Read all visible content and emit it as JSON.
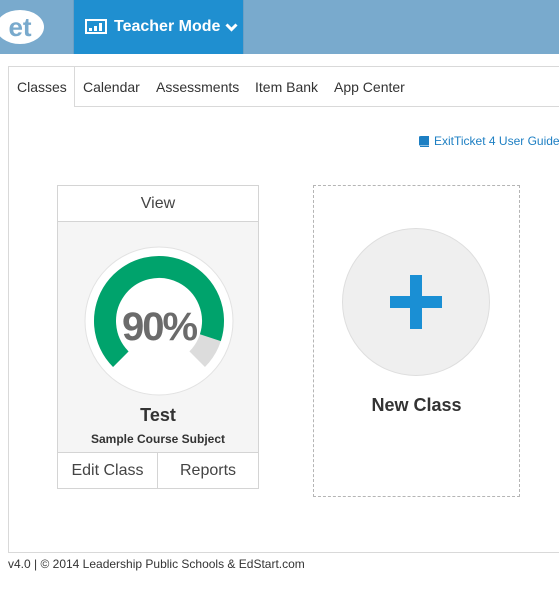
{
  "topbar": {
    "logo_text": "et",
    "mode_label": "Teacher Mode",
    "colors": {
      "bar": "#79aacd",
      "mode": "#1f8fd0"
    }
  },
  "tabs": [
    {
      "label": "Classes",
      "active": true
    },
    {
      "label": "Calendar",
      "active": false
    },
    {
      "label": "Assessments",
      "active": false
    },
    {
      "label": "Item Bank",
      "active": false
    },
    {
      "label": "App Center",
      "active": false
    }
  ],
  "guide_link": {
    "label": "ExitTicket 4 User Guide"
  },
  "class_card": {
    "view_label": "View",
    "score_text": "90%",
    "score_value": 90,
    "class_name": "Test",
    "subject": "Sample Course Subject",
    "edit_label": "Edit Class",
    "reports_label": "Reports",
    "gauge_color": "#00a36c"
  },
  "new_class": {
    "label": "New Class",
    "icon": "plus-icon",
    "color": "#1a8fd4"
  },
  "footer": {
    "text": "v4.0 | © 2014 Leadership Public Schools & EdStart.com"
  }
}
